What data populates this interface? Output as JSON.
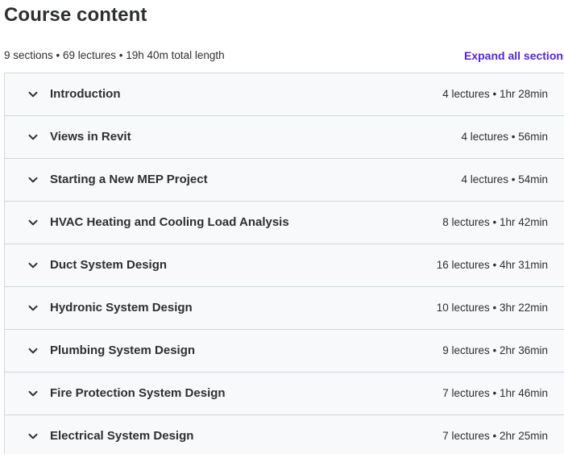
{
  "header": {
    "title": "Course content",
    "summary": "9 sections • 69 lectures • 19h 40m total length",
    "expand_all_label": "Expand all sections"
  },
  "sections": [
    {
      "title": "Introduction",
      "meta": "4 lectures • 1hr 28min"
    },
    {
      "title": "Views in Revit",
      "meta": "4 lectures • 56min"
    },
    {
      "title": "Starting a New MEP Project",
      "meta": "4 lectures • 54min"
    },
    {
      "title": "HVAC Heating and Cooling Load Analysis",
      "meta": "8 lectures • 1hr 42min"
    },
    {
      "title": "Duct System Design",
      "meta": "16 lectures • 4hr 31min"
    },
    {
      "title": "Hydronic System Design",
      "meta": "10 lectures • 3hr 22min"
    },
    {
      "title": "Plumbing System Design",
      "meta": "9 lectures • 2hr 36min"
    },
    {
      "title": "Fire Protection System Design",
      "meta": "7 lectures • 1hr 46min"
    },
    {
      "title": "Electrical System Design",
      "meta": "7 lectures • 2hr 25min"
    }
  ],
  "colors": {
    "accent": "#5624d0",
    "text": "#2d2f31",
    "row_background": "#f7f9fa",
    "border": "#d1d7dc"
  },
  "icons": {
    "section_toggle": "chevron-down-icon"
  }
}
